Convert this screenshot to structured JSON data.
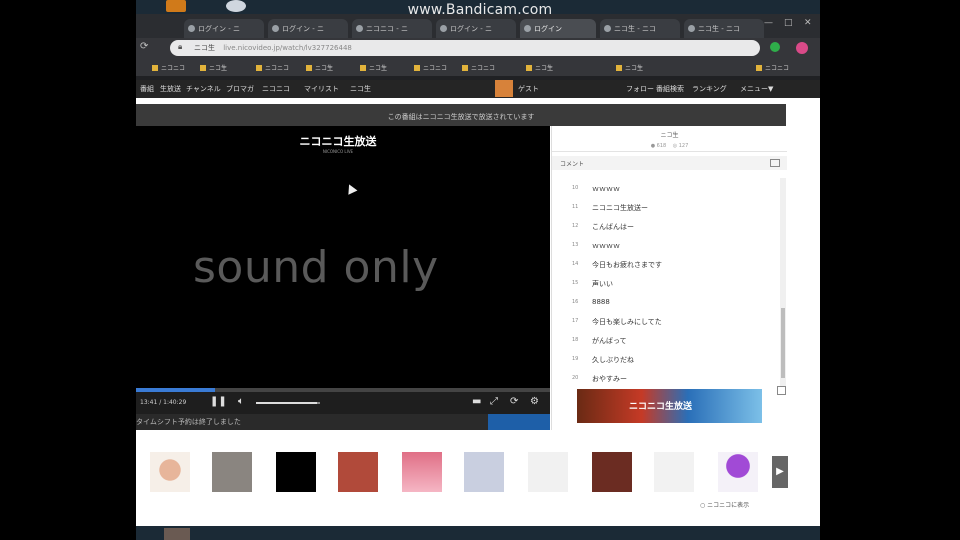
{
  "watermark": "www.Bandicam.com",
  "browser": {
    "tabs": [
      {
        "label": "ログイン - ニ"
      },
      {
        "label": "ログイン - ニ"
      },
      {
        "label": "ニコニコ - ニ"
      },
      {
        "label": "ログイン - ニ"
      },
      {
        "label": "ログイン"
      },
      {
        "label": "ニコ生 - ニコ"
      },
      {
        "label": "ニコ生 - ニコ"
      }
    ],
    "window_buttons": {
      "minimize": "—",
      "maximize": "□",
      "close": "✕"
    },
    "url_prefix": "ニコ生",
    "url": "live.nicovideo.jp/watch/lv327726448",
    "bookmarks": [
      "ニコニコ",
      "ニコ生",
      "ニコニコ",
      "ニコ生",
      "ニコ生",
      "ニコニコ",
      "ニコニコ",
      "ニコ生",
      "ニコ生",
      "ニコニコ"
    ]
  },
  "site_nav": {
    "items": [
      "番組",
      "生放送",
      "チャンネル",
      "ブロマガ",
      "ニコニコ",
      "マイリスト",
      "ニコ生"
    ],
    "user_name": "ゲスト",
    "right_items": [
      "フォロー",
      "番組検索",
      "ランキング",
      "メニュー▼"
    ]
  },
  "notice": "この番組はニコニコ生放送で放送されています",
  "player": {
    "channel_logo": "ニコニコ生放送",
    "channel_logo_sub": "NICONICO LIVE",
    "overlay_text": "sound only",
    "progress": 0.19,
    "time": "13:41 / 1:40:29",
    "volume": 0.95,
    "footer_text": "タイムシフト予約は終了しました"
  },
  "comments": {
    "header_title": "ニコ生",
    "stats": "● 618　 ◎ 127",
    "tab_label": "コメント",
    "items": [
      {
        "num": "10",
        "text": "ｗｗｗｗ"
      },
      {
        "num": "11",
        "text": "ニコニコ生放送ー"
      },
      {
        "num": "12",
        "text": "こんばんはー"
      },
      {
        "num": "13",
        "text": "ｗｗｗｗ"
      },
      {
        "num": "14",
        "text": "今日もお疲れさまです"
      },
      {
        "num": "15",
        "text": "声いい"
      },
      {
        "num": "16",
        "text": "8888"
      },
      {
        "num": "17",
        "text": "今日も楽しみにしてた"
      },
      {
        "num": "18",
        "text": "がんばって"
      },
      {
        "num": "19",
        "text": "久しぶりだね"
      },
      {
        "num": "20",
        "text": "おやすみー"
      }
    ]
  },
  "banner_text": "ニコニコ生放送",
  "thumb_next": "▶",
  "thumb_footer": "○ ニコニコに表示"
}
